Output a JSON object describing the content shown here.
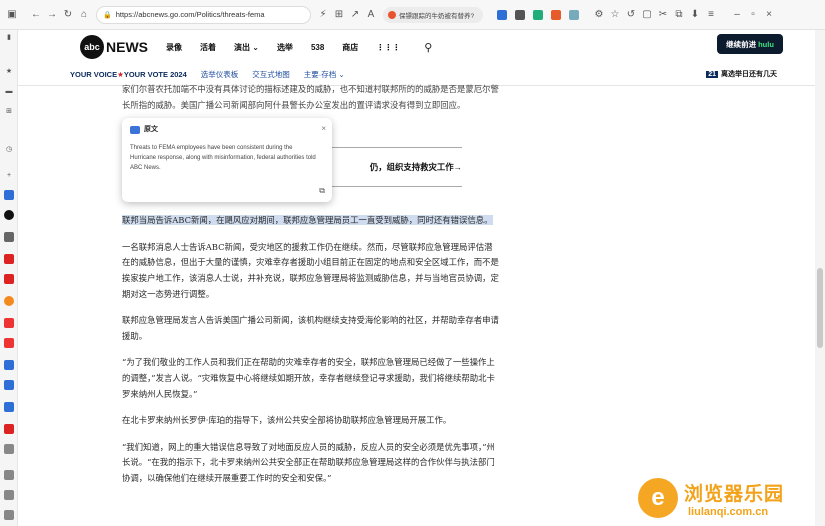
{
  "browser": {
    "url": "https://abcnews.go.com/Politics/threats-fema",
    "news_badge": "保镖跟踪的牛奶被有替养?"
  },
  "header": {
    "logo_mark": "abc",
    "logo_word": "NEWS",
    "nav": [
      "录像",
      "活着",
      "演出",
      "选举",
      "538",
      "商店"
    ],
    "hulu_button": "继续前进",
    "hulu_word": "hulu"
  },
  "subnav": {
    "yv_a": "YOUR VOICE",
    "yv_b": "YOUR VOTE 2024",
    "links": [
      "选举仪表板",
      "交互式地图",
      "主要·存档"
    ],
    "election_num": "21",
    "election_text": "离选举日还有几天"
  },
  "article": {
    "top_partial": "家们尔普农托加端不中没有具体讨论的描标述建及的威胁，也不知道村联邦所的的威胁是否是蒙厄尔警长所指的威胁。美国广播公司新闻部向阿什县警长办公室发出的置评请求没有得到立即回应。",
    "promo": "仍，组织支持救灾工作→",
    "p1": "联邦当局告诉ABC新闻，在飓风应对期间，联邦应急管理局员工一直受到威胁，同时还有错误信息。",
    "p2": "一名联邦消息人士告诉ABC新闻，受灾地区的援救工作仍在继续。然而，尽管联邦应急管理局评估潜在的威胁信息，但出于大量的谨慎，灾难幸存者援助小组目前正在固定的地点和安全区域工作，而不是挨家挨户地工作，该消息人士说，并补充说，联邦应急管理局将监测威胁信息，并与当地官员协调，定期对这一态势进行调整。",
    "p3": "联邦应急管理局发言人告诉美国广播公司新闻，该机构继续支持受海伦影响的社区，并帮助幸存者申请援助。",
    "p4": "“为了我们敬业的工作人员和我们正在帮助的灾难幸存者的安全，联邦应急管理局已经做了一些操作上的调整，”发言人说。“灾难恢复中心将继续如期开放，幸存者继续登记寻求援助，我们将继续帮助北卡罗来纳州人民恢复。”",
    "p5": "在北卡罗来纳州长罗伊·库珀的指导下，该州公共安全部将协助联邦应急管理局开展工作。",
    "p6": "“我们知道，网上的重大错误信息导致了对地面反应人员的威胁，反应人员的安全必须是优先事项，”州长说。“在我的指示下，北卡罗来纳州公共安全部正在帮助联邦应急管理局这样的合作伙伴与执法部门协调，以确保他们在继续开展重要工作时的安全和安保。”"
  },
  "popup": {
    "title": "原文",
    "body": "Threats to FEMA employees have been consistent during the Hurricane response, along with misinformation, federal authorities told ABC News."
  },
  "watermark": {
    "main": "浏览器乐园",
    "sub": "liulanqi.com.cn"
  }
}
